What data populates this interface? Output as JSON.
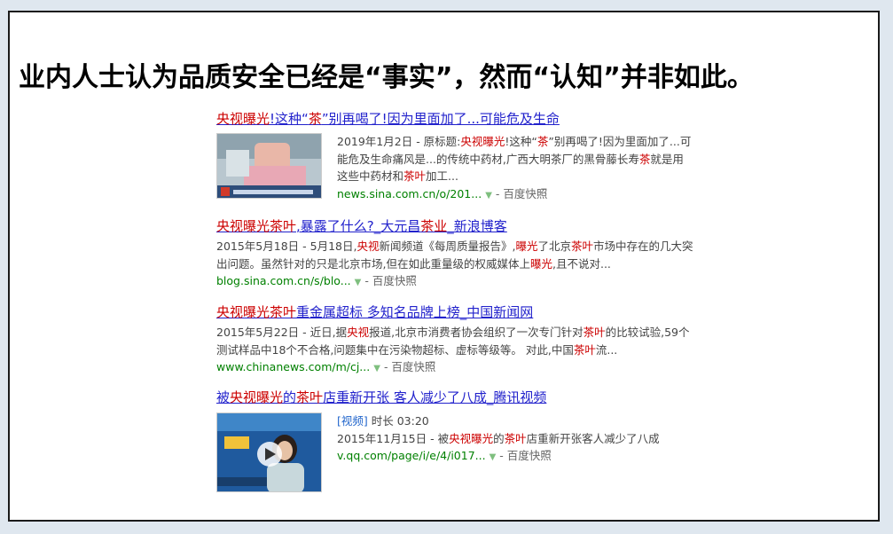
{
  "headline": "业内人士认为品质安全已经是“事实”，然而“认知”并非如此。",
  "results": [
    {
      "title_parts": [
        "央视曝光",
        "!这种“",
        "茶",
        "”别再喝了!因为里面加了...可能危及生命"
      ],
      "abstract_parts": [
        "2019年1月2日 - 原标题:",
        "央视曝光",
        "!这种“",
        "茶",
        "”别再喝了!因为里面加了...可能危及生命痛风是...的传统中药材,广西大明茶厂的黑骨藤长寿",
        "茶",
        "就是用这些中药材和",
        "茶叶",
        "加工..."
      ],
      "url": "news.sina.com.cn/o/201...",
      "snapshot": "百度快照"
    },
    {
      "title_parts": [
        "央视曝光茶叶",
        ",暴露了什么?_大元昌",
        "茶业",
        "_新浪博客"
      ],
      "abstract_parts": [
        "2015年5月18日 - 5月18日,",
        "央视",
        "新闻频道《每周质量报告》,",
        "曝光",
        "了北京",
        "茶叶",
        "市场中存在的几大突出问题。虽然针对的只是北京市场,但在如此重量级的权威媒体上",
        "曝光",
        ",且不说对..."
      ],
      "url": "blog.sina.com.cn/s/blo...",
      "snapshot": "百度快照"
    },
    {
      "title_parts": [
        "央视曝光茶叶",
        "重金属超标 多知名品牌上榜_中国新闻网"
      ],
      "abstract_parts": [
        "2015年5月22日 - 近日,据",
        "央视",
        "报道,北京市消费者协会组织了一次专门针对",
        "茶叶",
        "的比较试验,59个测试样品中18个不合格,问题集中在污染物超标、虚标等级等。 对此,中国",
        "茶叶",
        "流..."
      ],
      "url": "www.chinanews.com/m/cj...",
      "snapshot": "百度快照"
    },
    {
      "title_parts": [
        "被",
        "央视曝光",
        "的",
        "茶叶",
        "店重新开张 客人减少了八成_腾讯视频"
      ],
      "video_tag": "[视频]",
      "duration": "时长 03:20",
      "abstract_parts": [
        "2015年11月15日 - 被",
        "央视曝光",
        "的",
        "茶叶",
        "店重新开张客人减少了八成"
      ],
      "url": "v.qq.com/page/i/e/4/i017...",
      "snapshot": "百度快照"
    }
  ],
  "colors": {
    "highlight": "#cc0000",
    "link": "#2222cc",
    "url": "#008000"
  }
}
